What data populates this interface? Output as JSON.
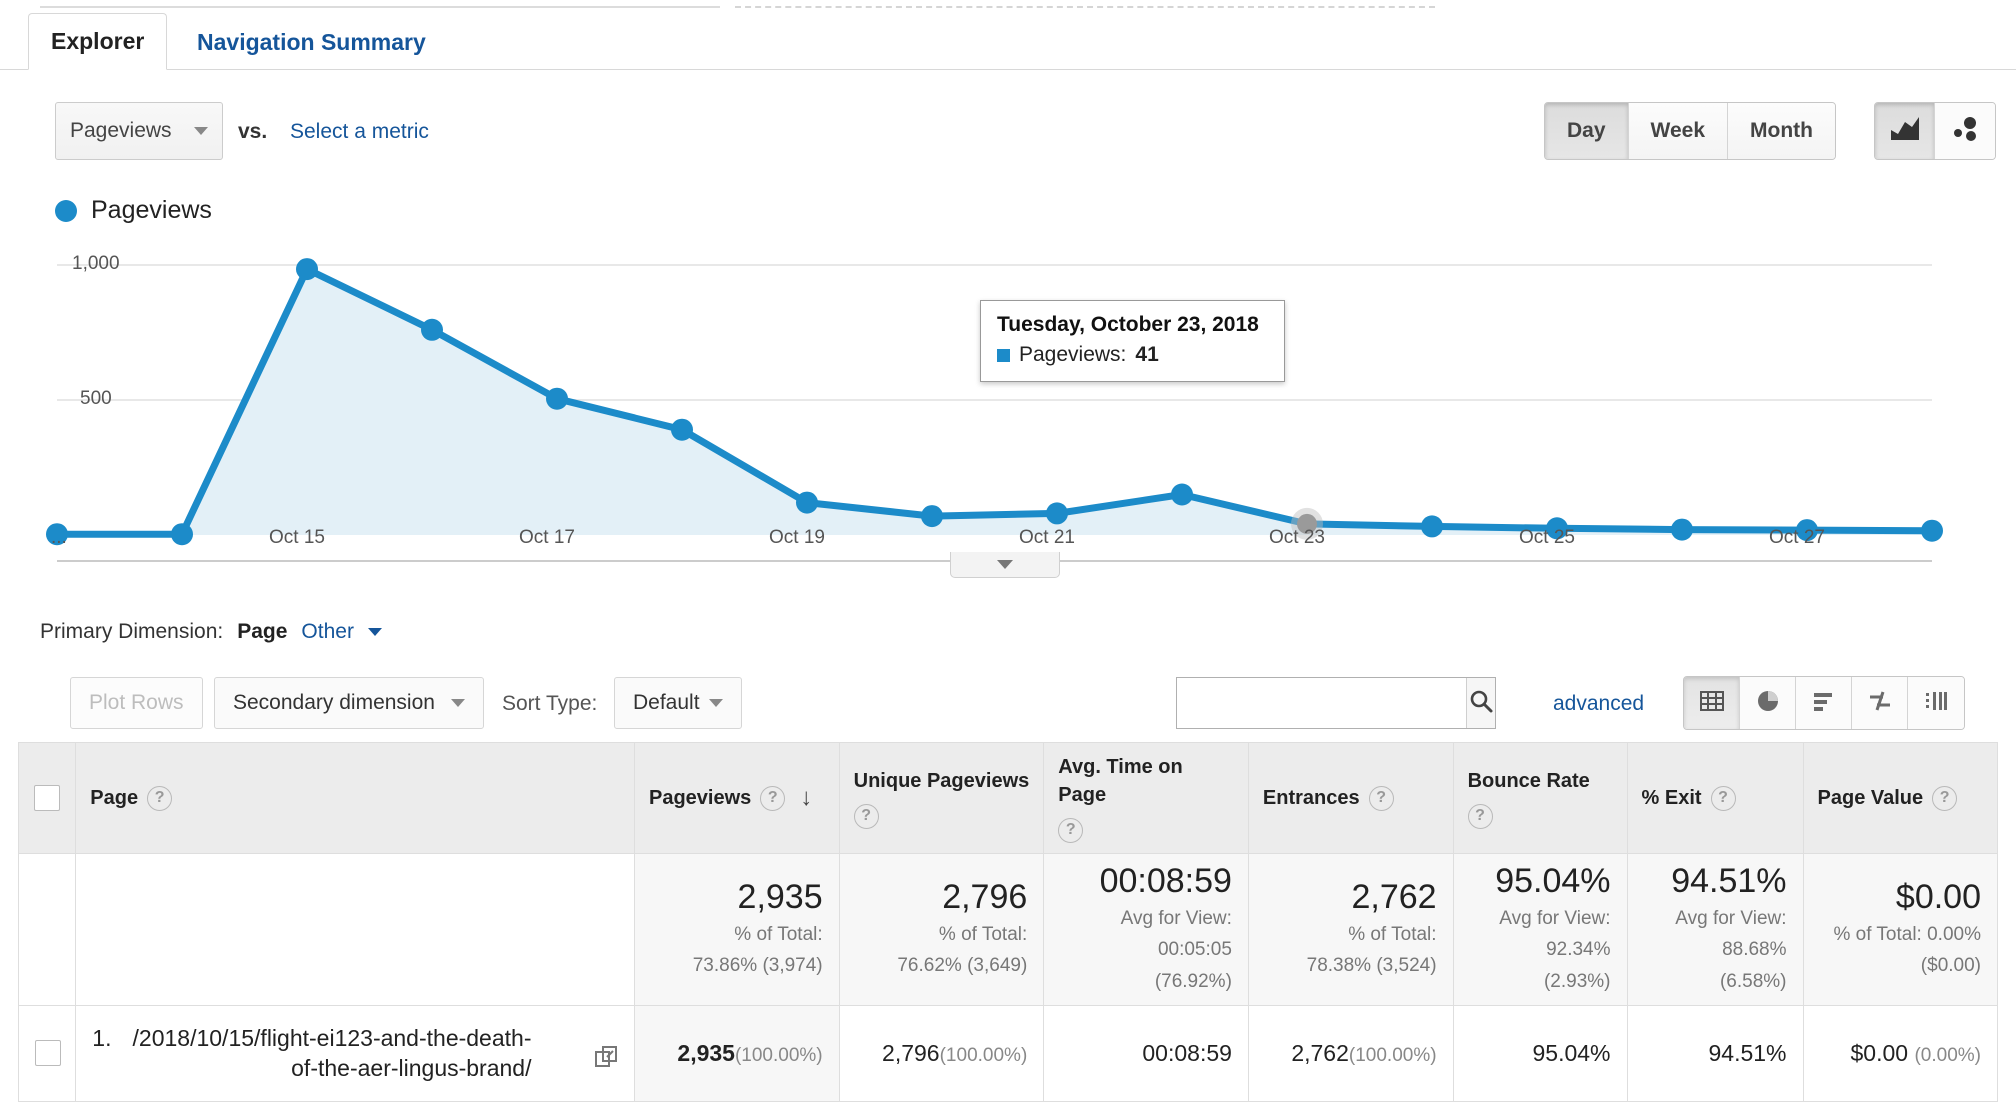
{
  "tabs": [
    {
      "label": "Explorer",
      "active": true
    },
    {
      "label": "Navigation Summary",
      "active": false
    }
  ],
  "metric_row": {
    "selected_metric": "Pageviews",
    "vs_label": "vs.",
    "select_a_metric": "Select a metric",
    "granularity": [
      "Day",
      "Week",
      "Month"
    ],
    "granularity_active": "Day",
    "chart_type_icons": [
      "line-chart-icon",
      "motion-chart-icon"
    ]
  },
  "legend": {
    "series_name": "Pageviews",
    "color": "#1c8bc9"
  },
  "tooltip": {
    "date": "Tuesday, October 23, 2018",
    "metric_label": "Pageviews:",
    "value": "41"
  },
  "primary_dimension": {
    "label": "Primary Dimension:",
    "value": "Page",
    "other": "Other"
  },
  "controls": {
    "plot_rows": "Plot Rows",
    "secondary_dimension": "Secondary dimension",
    "sort_type_label": "Sort Type:",
    "sort_type_value": "Default",
    "search_placeholder": "",
    "search_value": "",
    "advanced": "advanced",
    "view_icons": [
      "table-view-icon",
      "pie-chart-view-icon",
      "bar-chart-view-icon",
      "comparison-view-icon",
      "pivot-view-icon"
    ],
    "view_icon_active": "table-view-icon"
  },
  "table": {
    "headers": [
      {
        "label": "Page",
        "help": true
      },
      {
        "label": "Pageviews",
        "help": true,
        "sorted": true
      },
      {
        "label": "Unique Pageviews",
        "help": true
      },
      {
        "label": "Avg. Time on Page",
        "help": true
      },
      {
        "label": "Entrances",
        "help": true
      },
      {
        "label": "Bounce Rate",
        "help": true
      },
      {
        "label": "% Exit",
        "help": true
      },
      {
        "label": "Page Value",
        "help": true
      }
    ],
    "summary": {
      "pageviews": {
        "value": "2,935",
        "line1": "% of Total:",
        "line2": "73.86% (3,974)"
      },
      "unique_pageviews": {
        "value": "2,796",
        "line1": "% of Total:",
        "line2": "76.62% (3,649)"
      },
      "avg_time": {
        "value": "00:08:59",
        "line1": "Avg for View:",
        "line2": "00:05:05",
        "line3": "(76.92%)"
      },
      "entrances": {
        "value": "2,762",
        "line1": "% of Total:",
        "line2": "78.38% (3,524)"
      },
      "bounce_rate": {
        "value": "95.04%",
        "line1": "Avg for View:",
        "line2": "92.34%",
        "line3": "(2.93%)"
      },
      "exit_rate": {
        "value": "94.51%",
        "line1": "Avg for View:",
        "line2": "88.68%",
        "line3": "(6.58%)"
      },
      "page_value": {
        "value": "$0.00",
        "line1": "% of Total: 0.00%",
        "line2": "($0.00)"
      }
    },
    "rows": [
      {
        "rank": "1.",
        "page": "/2018/10/15/flight-ei123-and-the-death-of-the-aer-lingus-brand/",
        "pageviews": "2,935",
        "pageviews_pct": "(100.00%)",
        "unique_pageviews": "2,796",
        "unique_pageviews_pct": "(100.00%)",
        "avg_time": "00:08:59",
        "entrances": "2,762",
        "entrances_pct": "(100.00%)",
        "bounce_rate": "95.04%",
        "exit_rate": "94.51%",
        "page_value": "$0.00",
        "page_value_pct": "(0.00%)"
      }
    ]
  },
  "chart_data": {
    "type": "area",
    "title": "Pageviews",
    "xlabel": "",
    "ylabel": "",
    "ylim": [
      0,
      1150
    ],
    "yticks": [
      "500",
      "1,000"
    ],
    "ytick_values": [
      500,
      1000
    ],
    "grid": true,
    "legend_position": "top-left",
    "x_tick_labels": [
      "...",
      "Oct 15",
      "Oct 17",
      "Oct 19",
      "Oct 21",
      "Oct 23",
      "Oct 25",
      "Oct 27"
    ],
    "x": [
      "Oct 13",
      "Oct 14",
      "Oct 15",
      "Oct 16",
      "Oct 17",
      "Oct 18",
      "Oct 19",
      "Oct 20",
      "Oct 21",
      "Oct 22",
      "Oct 23",
      "Oct 24",
      "Oct 25",
      "Oct 26",
      "Oct 27",
      "Oct 28"
    ],
    "series": [
      {
        "name": "Pageviews",
        "color": "#1c8bc9",
        "fill": "#e3f0f7",
        "values": [
          3,
          3,
          985,
          760,
          505,
          390,
          120,
          70,
          80,
          150,
          41,
          32,
          25,
          20,
          18,
          16
        ]
      }
    ],
    "highlighted_point": {
      "x": "Oct 23",
      "y": 41,
      "label": "Tuesday, October 23, 2018"
    }
  }
}
